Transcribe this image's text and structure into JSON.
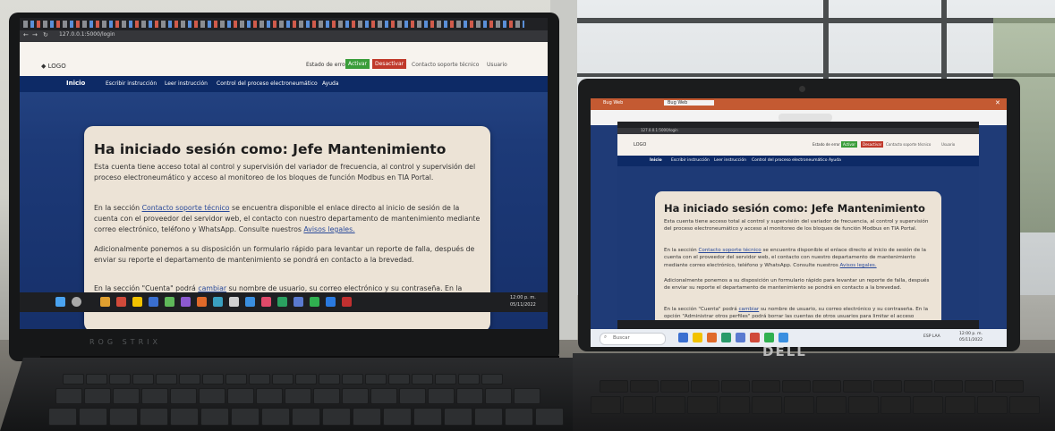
{
  "scene": {
    "laptop1_brand": "ROG STRIX",
    "laptop2_brand": "DELL"
  },
  "app": {
    "url": "127.0.0.1:5000/login",
    "logo": "LOGO",
    "status_label": "Estado de error",
    "activate_button": "Activar",
    "deactivate_button": "Desactivar",
    "contact_link": "Contacto soporte técnico",
    "account_link": "Usuario",
    "menu": [
      "Inicio",
      "Escribir instrucción",
      "Leer instrucción",
      "Control del proceso electroneumático",
      "Ayuda"
    ],
    "card": {
      "title": "Ha iniciado sesión como: Jefe Mantenimiento",
      "p1": "Esta cuenta tiene acceso total al control y supervisión del variador de frecuencia, al control y supervisión del proceso electroneumático y acceso al monitoreo de los bloques de función Modbus en TIA Portal.",
      "p2_a": "En la sección ",
      "p2_link1": "Contacto soporte técnico",
      "p2_b": " se encuentra disponible el enlace directo al inicio de sesión de la cuenta con el proveedor del servidor web, el contacto con nuestro departamento de mantenimiento mediante correo electrónico, teléfono y WhatsApp. Consulte nuestros ",
      "p2_link2": "Avisos legales.",
      "p3": "Adicionalmente ponemos a su disposición un formulario rápido para levantar un reporte de falla, después de enviar su reporte el departamento de mantenimiento se pondrá en contacto a la brevedad.",
      "p4_a": "En la sección \"Cuenta\" podrá ",
      "p4_link": "cambiar",
      "p4_b": " su nombre de usuario, su correo electrónico y su contraseña. En la opción \"Administrar otros perfiles\" podrá borrar las cuentas de otros usuarios para limitar el acceso"
    }
  },
  "laptop2": {
    "edge_tab1": "Bug Web",
    "edge_tab2": "Bug Web",
    "taskbar_search": "Buscar",
    "clock_time": "12:00 p. m.",
    "clock_date": "05/11/2022",
    "lang": "ESP LAA"
  },
  "colors": {
    "navbar_blue": "#0d2a66",
    "page_bg_blue": "#1f3b77",
    "card_bg": "#ece3d6",
    "activate_green": "#3a9d3a",
    "deactivate_red": "#c0392b",
    "edge_accent": "#c45a32"
  }
}
